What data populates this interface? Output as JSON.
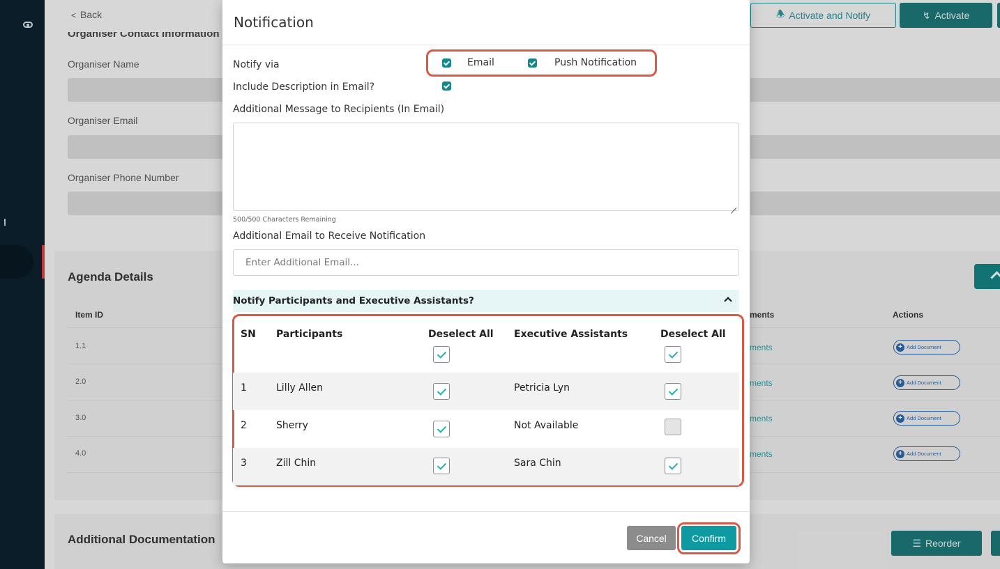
{
  "page": {
    "back_label": "Back",
    "organiser_heading": "Organiser Contact Information",
    "organiser_name_label": "Organiser Name",
    "organiser_email_label": "Organiser Email",
    "organiser_phone_label": "Organiser Phone Number",
    "agenda_title": "Agenda Details",
    "agenda_columns": {
      "item_id": "Item ID",
      "documents": "ments",
      "actions": "Actions"
    },
    "agenda_rows": [
      {
        "item_id": "1.1",
        "documents": "ments",
        "action": "Add Document"
      },
      {
        "item_id": "2.0",
        "documents": "ments",
        "action": "Add Document"
      },
      {
        "item_id": "3.0",
        "documents": "ments",
        "action": "Add Document"
      },
      {
        "item_id": "4.0",
        "documents": "ments",
        "action": "Add Document"
      }
    ],
    "additional_docs_title": "Additional Documentation",
    "reorder_label": "Reorder",
    "activate_notify_label": "Activate and Notify",
    "activate_label": "Activate",
    "colors": {
      "sidebar": "#0b1f2b",
      "accent": "#1b6e70"
    }
  },
  "modal": {
    "title": "Notification",
    "notify_via_label": "Notify via",
    "notify_options": [
      {
        "label": "Email",
        "checked": true
      },
      {
        "label": "Push Notification",
        "checked": true
      }
    ],
    "include_description_label": "Include Description in Email?",
    "include_description_checked": true,
    "additional_message_label": "Additional Message to Recipients (In Email)",
    "additional_message_value": "",
    "characters_remaining": "500/500 Characters Remaining",
    "additional_email_label": "Additional Email to Receive Notification",
    "additional_email_placeholder": "Enter Additional Email...",
    "accordion_title": "Notify Participants and Executive Assistants?",
    "table": {
      "columns": {
        "sn": "SN",
        "participants": "Participants",
        "deselect_participants": "Deselect All",
        "executive_assistants": "Executive Assistants",
        "deselect_assistants": "Deselect All"
      },
      "select_all_participants": true,
      "select_all_assistants": true,
      "rows": [
        {
          "sn": "1",
          "participant": "Lilly Allen",
          "participant_checked": true,
          "assistant": "Petricia Lyn",
          "assistant_checked": true
        },
        {
          "sn": "2",
          "participant": "Sherry",
          "participant_checked": true,
          "assistant": "Not Available",
          "assistant_checked": false
        },
        {
          "sn": "3",
          "participant": "Zill Chin",
          "participant_checked": true,
          "assistant": "Sara Chin",
          "assistant_checked": true
        }
      ]
    },
    "cancel_label": "Cancel",
    "confirm_label": "Confirm",
    "colors": {
      "teal": "#14878c",
      "highlight": "#d65a45"
    }
  }
}
